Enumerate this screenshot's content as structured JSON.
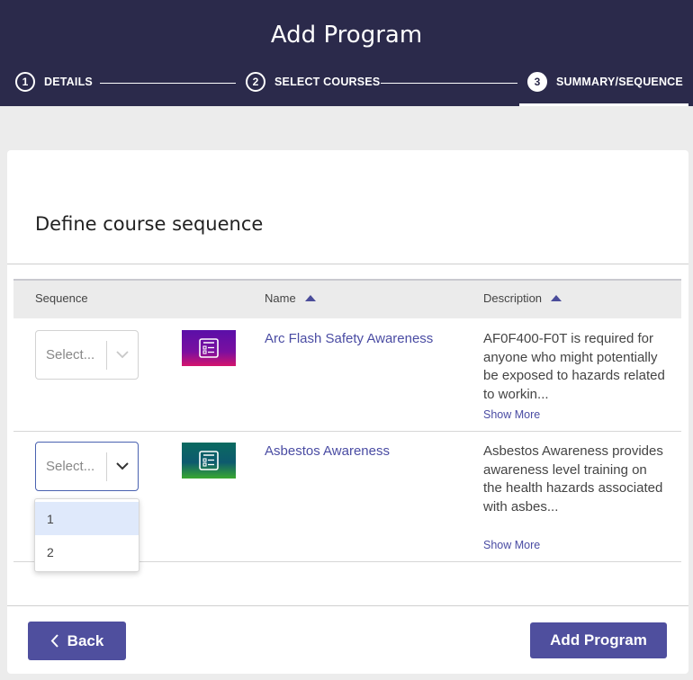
{
  "header": {
    "title": "Add Program",
    "steps": [
      {
        "num": "1",
        "label": "DETAILS"
      },
      {
        "num": "2",
        "label": "SELECT COURSES"
      },
      {
        "num": "3",
        "label": "SUMMARY/SEQUENCE"
      }
    ],
    "active_step": 3
  },
  "section": {
    "title": "Define course sequence"
  },
  "table": {
    "columns": [
      {
        "label": "Sequence",
        "sortable": false
      },
      {
        "label": "Name",
        "sortable": true,
        "sort": "ascending"
      },
      {
        "label": "Description",
        "sortable": true,
        "sort": "ascending"
      }
    ],
    "rows": [
      {
        "select_placeholder": "Select...",
        "thumbnail_color": "purple",
        "name": "Arc Flash Safety Awareness",
        "description": "AF0F400-F0T is required for anyone who might potentially be exposed to hazards related to workin...",
        "show_more": "Show More"
      },
      {
        "select_placeholder": "Select...",
        "thumbnail_color": "green",
        "name": "Asbestos Awareness",
        "description": "Asbestos Awareness provides awareness level training on the health hazards associated with asbes...",
        "show_more": "Show More"
      }
    ]
  },
  "dropdown": {
    "options": [
      "1",
      "2"
    ],
    "highlighted": "1"
  },
  "footer": {
    "back_label": "Back",
    "submit_label": "Add Program"
  },
  "colors": {
    "header_bg": "#2b2a4b",
    "accent": "#4f4f9e",
    "link": "#4a4ca3"
  },
  "icons": {
    "thumbnail": "course-icon",
    "back": "chevron-left-icon",
    "sort": "sort-asc-icon",
    "dropdown": "chevron-down-icon"
  }
}
